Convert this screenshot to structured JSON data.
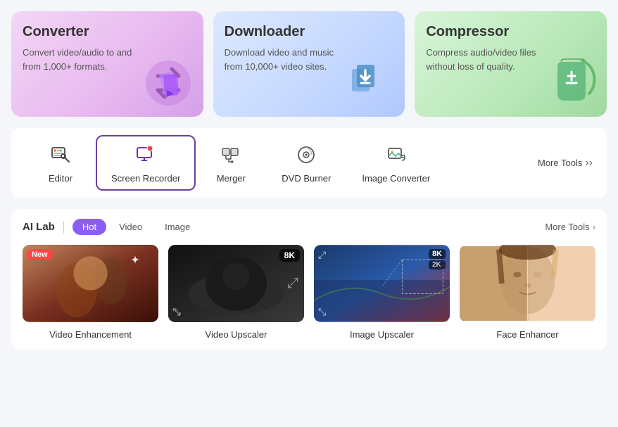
{
  "topCards": [
    {
      "id": "converter",
      "title": "Converter",
      "desc": "Convert video/audio to and from 1,000+ formats.",
      "bgClass": "card-converter",
      "iconEmoji": "🔄"
    },
    {
      "id": "downloader",
      "title": "Downloader",
      "desc": "Download video and music from 10,000+ video sites.",
      "bgClass": "card-downloader",
      "iconEmoji": "⬇️"
    },
    {
      "id": "compressor",
      "title": "Compressor",
      "desc": "Compress audio/video files without loss of quality.",
      "bgClass": "card-compressor",
      "iconEmoji": "🗜️"
    }
  ],
  "tools": [
    {
      "id": "editor",
      "label": "Editor",
      "active": false
    },
    {
      "id": "screen-recorder",
      "label": "Screen Recorder",
      "active": true
    },
    {
      "id": "merger",
      "label": "Merger",
      "active": false
    },
    {
      "id": "dvd-burner",
      "label": "DVD Burner",
      "active": false
    },
    {
      "id": "image-converter",
      "label": "Image Converter",
      "active": false
    }
  ],
  "moreToolsLabel": "More Tools",
  "aiLab": {
    "title": "AI Lab",
    "tabs": [
      {
        "id": "hot",
        "label": "Hot",
        "active": true
      },
      {
        "id": "video",
        "label": "Video",
        "active": false
      },
      {
        "id": "image",
        "label": "Image",
        "active": false
      }
    ],
    "moreToolsLabel": "More Tools",
    "cards": [
      {
        "id": "video-enhancement",
        "label": "Video Enhancement",
        "badge": "New",
        "badgeType": "new"
      },
      {
        "id": "video-upscaler",
        "label": "Video Upscaler",
        "badge": "8K",
        "badgeType": "8k"
      },
      {
        "id": "image-upscaler",
        "label": "Image Upscaler",
        "badge": "8K/2K",
        "badgeType": "resolution"
      },
      {
        "id": "face-enhancer",
        "label": "Face Enhancer",
        "badge": null,
        "badgeType": null
      }
    ]
  }
}
